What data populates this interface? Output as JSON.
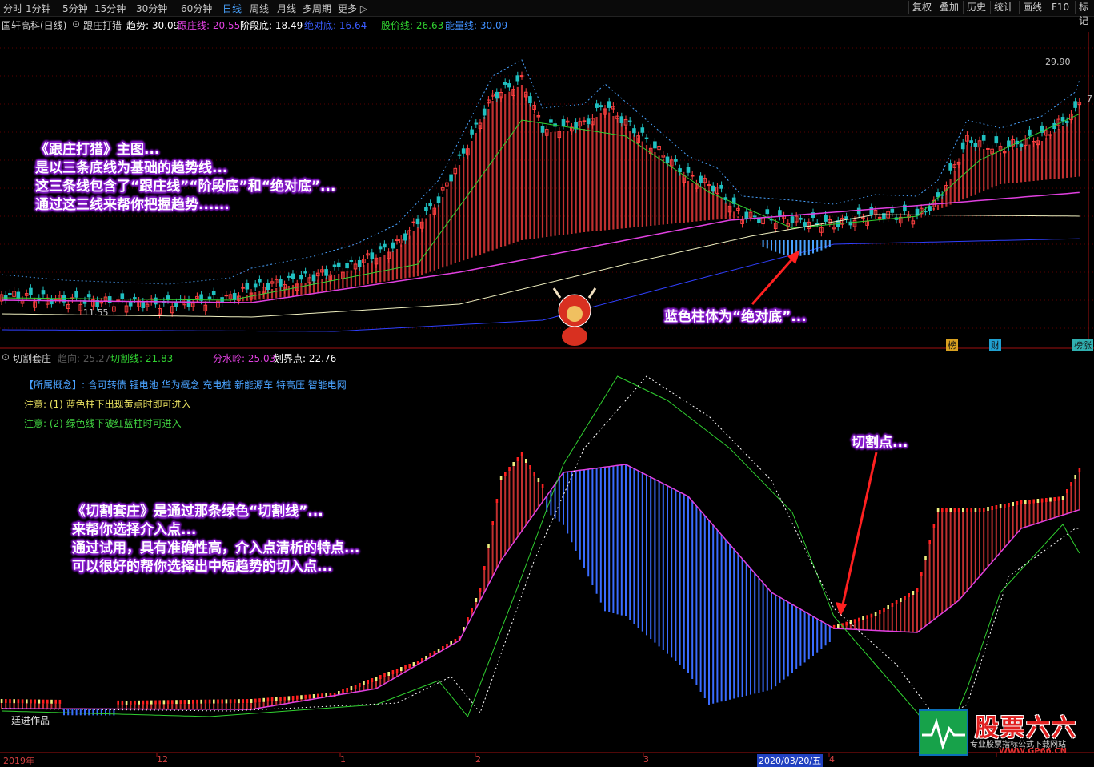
{
  "periods": [
    "分时",
    "1分钟",
    "5分钟",
    "15分钟",
    "30分钟",
    "60分钟",
    "日线",
    "周线",
    "月线",
    "多周期",
    "更多"
  ],
  "active_period": "日线",
  "tools": [
    "复权",
    "叠加",
    "历史",
    "统计",
    "画线",
    "F10",
    "标记"
  ],
  "main_info": {
    "stock": "国轩高科(日线)",
    "indicator": "跟庄打猎",
    "items": [
      {
        "label": "趋势: 30.09",
        "color": "#ffffff"
      },
      {
        "label": "跟庄线: 20.55",
        "color": "#e040e0"
      },
      {
        "label": "阶段底: 18.49",
        "color": "#ffffff"
      },
      {
        "label": "绝对底: 16.64",
        "color": "#3a5cff"
      },
      {
        "label": "股价线: 26.63",
        "color": "#30d030"
      },
      {
        "label": "能量线: 30.09",
        "color": "#4090ff"
      }
    ]
  },
  "sub_info": {
    "indicator": "切割套庄",
    "items": [
      {
        "label": "趋向: 25.27",
        "color": "#555555"
      },
      {
        "label": "切割线: 21.83",
        "color": "#30d030"
      },
      {
        "label": "分水岭: 25.03",
        "color": "#e040e0"
      },
      {
        "label": "划界点: 22.76",
        "color": "#ffffff"
      }
    ]
  },
  "price_labels": {
    "high": "29.90",
    "low": "11.55",
    "right_tick": "7"
  },
  "corner_tags": [
    "榜",
    "财",
    "榜涨"
  ],
  "annotations": {
    "main_desc": [
      "《跟庄打猎》主图...",
      "是以三条底线为基础的趋势线...",
      "这三条线包含了“跟庄线”“阶段底”和“绝对底”...",
      "通过这三线来帮你把握趋势......"
    ],
    "blue_bar": "蓝色柱体为“绝对底”...",
    "cut_point": "切割点...",
    "sub_desc": [
      "《切割套庄》是通过那条绿色“切割线”...",
      "来帮你选择介入点...",
      "通过试用，具有准确性高，介入点清析的特点...",
      "可以很好的帮你选择出中短趋势的切入点..."
    ]
  },
  "notes": {
    "concept_label": "【所属概念】:",
    "concepts": "含可转债 锂电池 华为概念 充电桩 新能源车 特高压 智能电网",
    "note1": "注意: (1) 蓝色柱下出现黄点时即可进入",
    "note2": "注意: (2) 绿色线下破红蓝柱时可进入"
  },
  "author": "廷进作品",
  "date_axis": [
    "2019年",
    "12",
    "1",
    "2",
    "3",
    "2020/03/20/五",
    "4"
  ],
  "logo": {
    "title": "股票六六",
    "subtitle": "专业股票指标公式下载网站",
    "url": "WWW.GP66.CN"
  },
  "colors": {
    "up": "#ff4040",
    "down": "#20c0c0",
    "axis": "#a01010",
    "cut_line": "#30d030",
    "watershed": "#e040e0"
  }
}
